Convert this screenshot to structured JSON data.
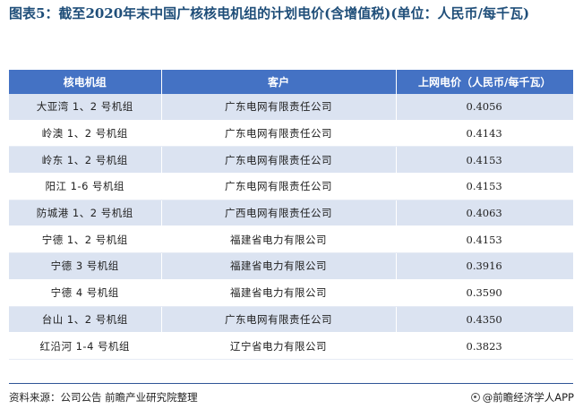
{
  "title": "图表5：截至2020年末中国广核核电机组的计划电价(含增值税)(单位：人民币/每千瓦)",
  "table": {
    "headers": [
      "核电机组",
      "客户",
      "上网电价（人民币/每千瓦）"
    ],
    "rows": [
      {
        "unit": "大亚湾 1、2 号机组",
        "customer": "广东电网有限责任公司",
        "price": "0.4056"
      },
      {
        "unit": "岭澳 1、2 号机组",
        "customer": "广东电网有限责任公司",
        "price": "0.4143"
      },
      {
        "unit": "岭东 1、2 号机组",
        "customer": "广东电网有限责任公司",
        "price": "0.4153"
      },
      {
        "unit": "阳江 1-6 号机组",
        "customer": "广东电网有限责任公司",
        "price": "0.4153"
      },
      {
        "unit": "防城港 1、2 号机组",
        "customer": "广西电网有限责任公司",
        "price": "0.4063"
      },
      {
        "unit": "宁德 1、2 号机组",
        "customer": "福建省电力有限公司",
        "price": "0.4153"
      },
      {
        "unit": "宁德 3 号机组",
        "customer": "福建省电力有限公司",
        "price": "0.3916"
      },
      {
        "unit": "宁德 4 号机组",
        "customer": "福建省电力有限公司",
        "price": "0.3590"
      },
      {
        "unit": "台山 1、2 号机组",
        "customer": "广东电网有限责任公司",
        "price": "0.4350"
      },
      {
        "unit": "红沿河 1-4 号机组",
        "customer": "辽宁省电力有限公司",
        "price": "0.3823"
      }
    ]
  },
  "footer": {
    "source": "资料来源：公司公告 前瞻产业研究院整理",
    "brand": "@前瞻经济学人APP"
  }
}
